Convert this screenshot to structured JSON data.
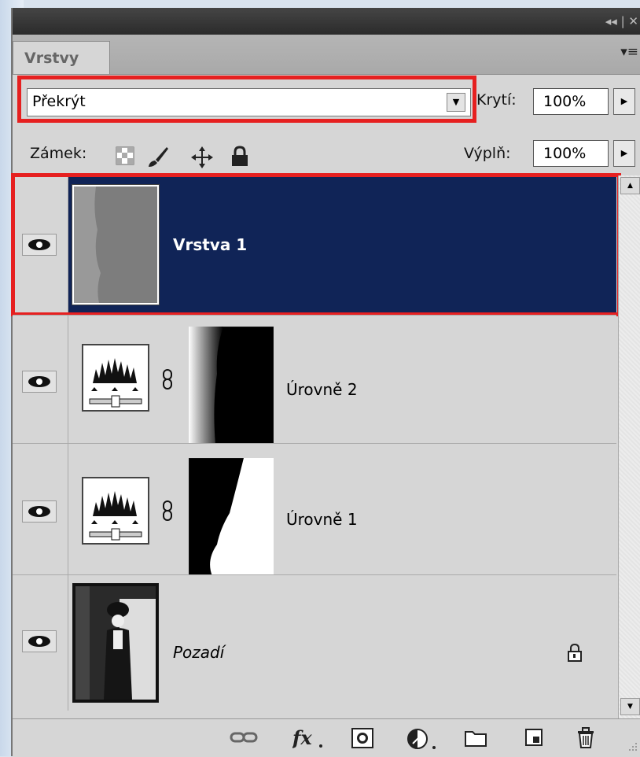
{
  "panel": {
    "tab_label": "Vrstvy",
    "collapse_glyph": "◂◂ | ✕",
    "menu_glyph": "▾≡"
  },
  "blend_mode": {
    "value": "Překrýt"
  },
  "opacity": {
    "label": "Krytí:",
    "value": "100%"
  },
  "fill": {
    "label": "Výplň:",
    "value": "100%"
  },
  "lock": {
    "label": "Zámek:",
    "icons": [
      "lock-transparency-icon",
      "lock-paint-brush-icon",
      "lock-move-icon",
      "lock-all-icon"
    ]
  },
  "layers": [
    {
      "name": "Vrstva 1",
      "selected": true,
      "visible": true,
      "type": "pixel"
    },
    {
      "name": "Úrovně 2",
      "selected": false,
      "visible": true,
      "type": "adjustment-levels-with-mask"
    },
    {
      "name": "Úrovně 1",
      "selected": false,
      "visible": true,
      "type": "adjustment-levels-with-mask"
    },
    {
      "name": "Pozadí",
      "selected": false,
      "visible": true,
      "type": "background",
      "locked": true
    }
  ],
  "bottom_icons": [
    "link-layers-icon",
    "fx-icon",
    "add-mask-icon",
    "adjustment-layer-icon",
    "folder-icon",
    "new-layer-icon",
    "trash-icon"
  ],
  "colors": {
    "selection": "#102457",
    "highlight": "#e62020",
    "panel": "#d6d6d6"
  }
}
